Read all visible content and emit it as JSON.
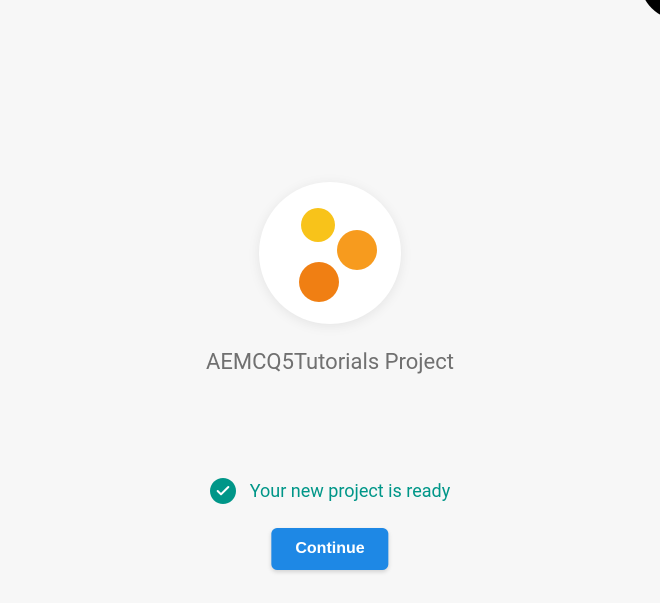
{
  "project": {
    "title": "AEMCQ5Tutorials Project"
  },
  "status": {
    "message": "Your new project is ready"
  },
  "actions": {
    "continue_label": "Continue"
  },
  "logo": {
    "dot1_color": "#f8c31a",
    "dot2_color": "#f79b1e",
    "dot3_color": "#f07f13"
  },
  "colors": {
    "accent_teal": "#009688",
    "accent_blue": "#1e88e5",
    "text_muted": "#707070",
    "background": "#f7f7f7"
  }
}
